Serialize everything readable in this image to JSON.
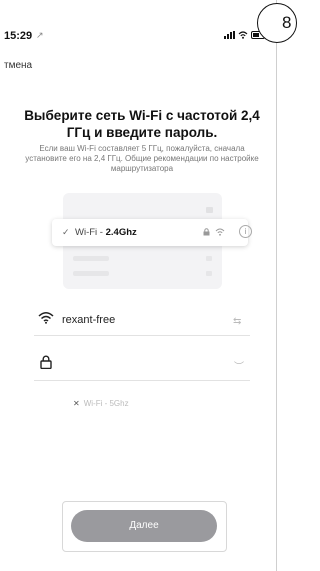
{
  "status_bar": {
    "time": "15:29",
    "location_arrow": "↗",
    "signal_label": "▂▄▆",
    "wifi_label": "wifi-icon",
    "battery_label": "battery-icon"
  },
  "page_badge": "8",
  "nav": {
    "cancel_label": "тмена"
  },
  "header": {
    "title": "Выберите сеть Wi-Fi с частотой 2,4 ГГц и введите пароль.",
    "subtitle": "Если ваш Wi-Fi составляет 5 ГГц, пожалуйста, сначала установите его на 2,4 ГГц. Общие рекомендации по настройке маршрутизатора"
  },
  "illustration": {
    "row_5ghz": {
      "prefix": "Wi-Fi - ",
      "band": "5Ghz"
    },
    "row_24ghz": {
      "prefix": "Wi-Fi - ",
      "band": "2.4Ghz"
    },
    "info_glyph": "i"
  },
  "form": {
    "ssid_value": "rexant-free",
    "password_value": "",
    "swap_glyph": "⇆",
    "eye_glyph": "︶"
  },
  "footer": {
    "next_label": "Далее"
  },
  "colors": {
    "button_bg": "#9a9a9e",
    "button_text": "#ffffff",
    "illustration_bg": "#f3f3f5"
  }
}
